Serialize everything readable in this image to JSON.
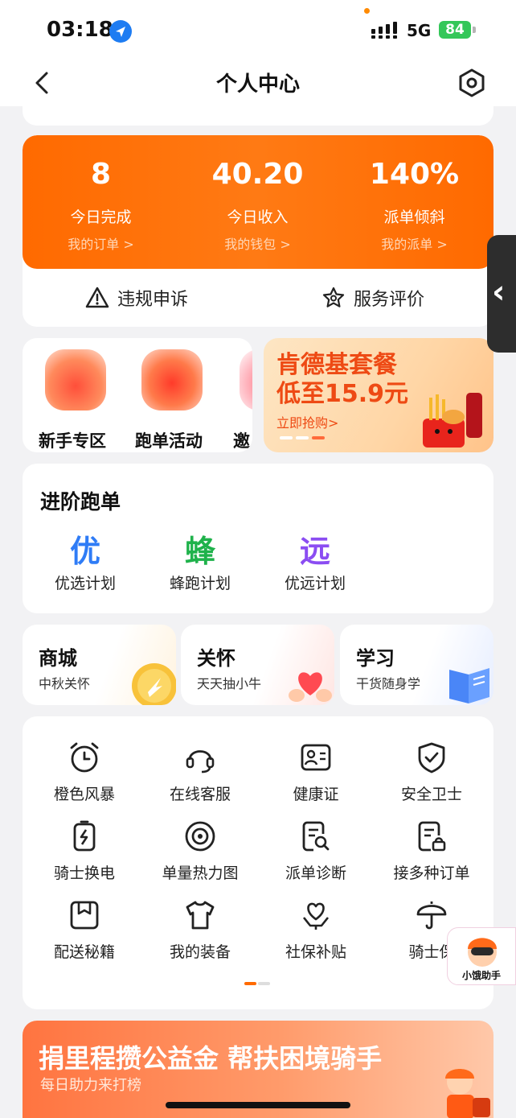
{
  "status_bar": {
    "time": "03:18",
    "network": "5G",
    "battery": "84"
  },
  "nav": {
    "title": "个人中心"
  },
  "stats": [
    {
      "value": "8",
      "label": "今日完成",
      "link": "我的订单 >"
    },
    {
      "value": "40.20",
      "label": "今日收入",
      "link": "我的钱包 >"
    },
    {
      "value": "140%",
      "label": "派单倾斜",
      "link": "我的派单 >"
    }
  ],
  "actions": {
    "appeal": "违规申诉",
    "review": "服务评价"
  },
  "quick_entries": [
    {
      "label": "新手专区",
      "icon": "gift-box-icon"
    },
    {
      "label": "跑单活动",
      "icon": "red-pouch-icon"
    },
    {
      "label": "邀",
      "icon": "invite-icon"
    }
  ],
  "promo_banner": {
    "title": "肯德基套餐",
    "subtitle": "低至15.9元",
    "cta": "立即抢购>"
  },
  "advanced": {
    "title": "进阶跑单",
    "items": [
      {
        "char": "优",
        "label": "优选计划",
        "color": "#2f7cf6"
      },
      {
        "char": "蜂",
        "label": "蜂跑计划",
        "color": "#1fb24b"
      },
      {
        "char": "远",
        "label": "优远计划",
        "color": "#8b4df2"
      }
    ]
  },
  "tiles": [
    {
      "title": "商城",
      "sub": "中秋关怀"
    },
    {
      "title": "关怀",
      "sub": "天天抽小牛"
    },
    {
      "title": "学习",
      "sub": "干货随身学"
    }
  ],
  "tools": [
    {
      "label": "橙色风暴",
      "icon": "alarm-clock-icon"
    },
    {
      "label": "在线客服",
      "icon": "headset-icon"
    },
    {
      "label": "健康证",
      "icon": "id-card-icon"
    },
    {
      "label": "安全卫士",
      "icon": "shield-check-icon"
    },
    {
      "label": "骑士换电",
      "icon": "battery-swap-icon"
    },
    {
      "label": "单量热力图",
      "icon": "heatmap-target-icon"
    },
    {
      "label": "派单诊断",
      "icon": "doc-search-icon"
    },
    {
      "label": "接多种订单",
      "icon": "doc-lock-icon"
    },
    {
      "label": "配送秘籍",
      "icon": "bookmark-box-icon"
    },
    {
      "label": "我的装备",
      "icon": "tshirt-icon"
    },
    {
      "label": "社保补贴",
      "icon": "heart-hand-icon"
    },
    {
      "label": "骑士保",
      "icon": "umbrella-icon"
    }
  ],
  "assistant": {
    "label": "小饿助手"
  },
  "charity": {
    "title": "捐里程攒公益金 帮扶困境骑手",
    "sub": "每日助力来打榜"
  },
  "colors": {
    "accent": "#ff6a00",
    "banner_red": "#ee4a14"
  }
}
